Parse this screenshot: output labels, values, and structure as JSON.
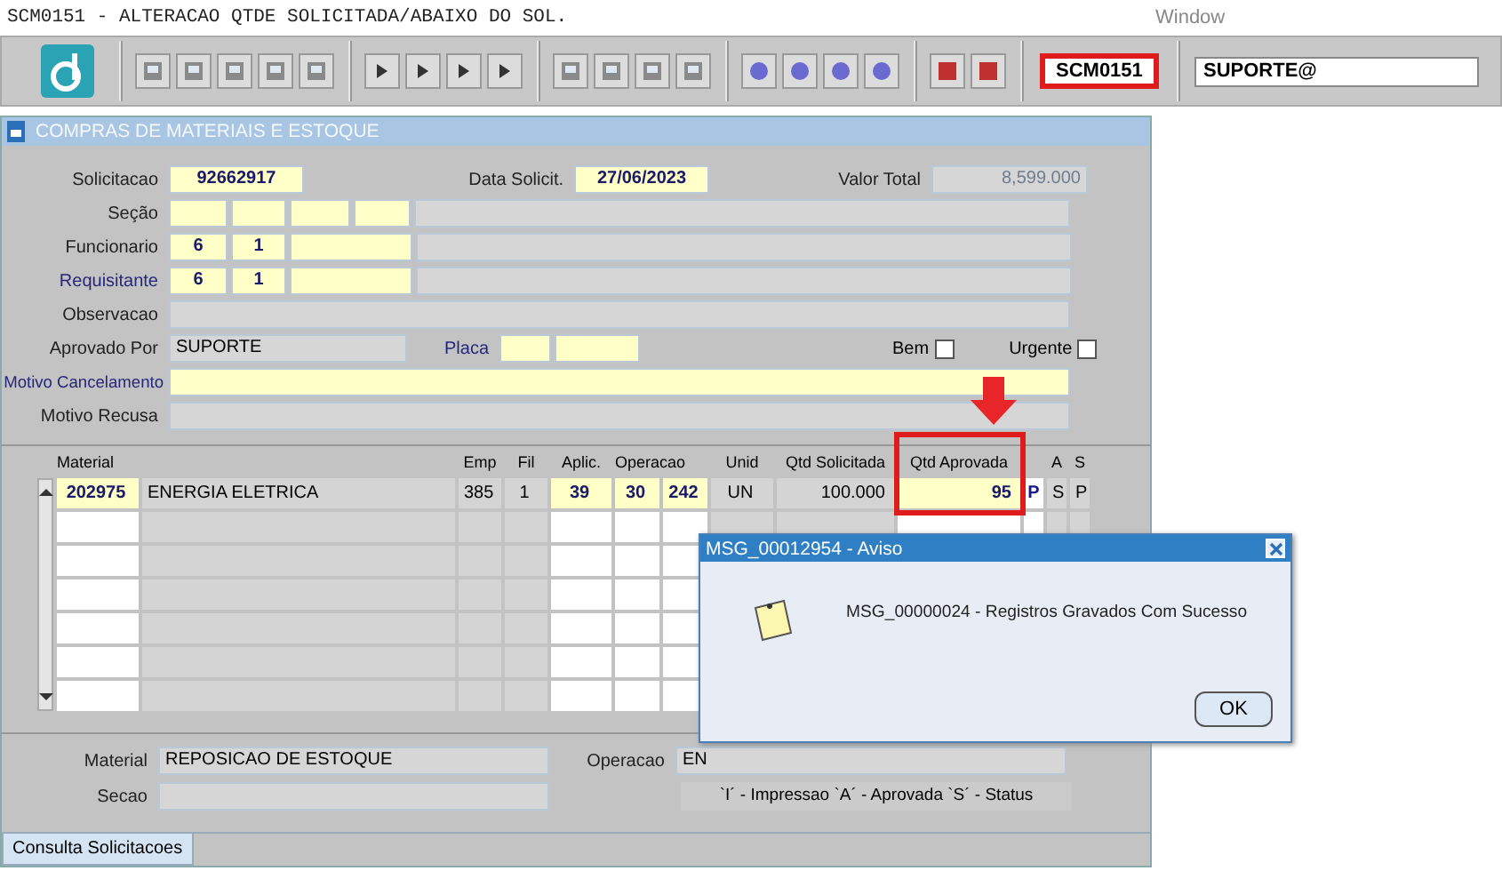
{
  "title_bar": {
    "title": "SCM0151 - ALTERACAO QTDE SOLICITADA/ABAIXO DO SOL.",
    "menu": "Window"
  },
  "toolbar": {
    "form_code": "SCM0151",
    "user": "SUPORTE@"
  },
  "panel": {
    "title": "COMPRAS DE MATERIAIS E ESTOQUE"
  },
  "form": {
    "solicitacao": {
      "label": "Solicitacao",
      "value": "92662917"
    },
    "data_solicit": {
      "label": "Data Solicit.",
      "value": "27/06/2023"
    },
    "valor_total": {
      "label": "Valor Total",
      "value": "8,599.000"
    },
    "secao": {
      "label": "Seção"
    },
    "funcionario": {
      "label": "Funcionario",
      "values": [
        "6",
        "1"
      ]
    },
    "requisitante": {
      "label": "Requisitante",
      "values": [
        "6",
        "1"
      ]
    },
    "observacao": {
      "label": "Observacao"
    },
    "aprovado_por": {
      "label": "Aprovado Por",
      "value": "SUPORTE"
    },
    "placa": {
      "label": "Placa"
    },
    "checkboxes": [
      {
        "label": "Bem",
        "checked": false
      },
      {
        "label": "Urgente",
        "checked": false
      }
    ],
    "motivo_cancelamento": {
      "label": "Motivo Cancelamento"
    },
    "motivo_recusa": {
      "label": "Motivo Recusa"
    }
  },
  "table": {
    "columns": [
      "Material",
      "",
      "Emp",
      "Fil",
      "Aplic.",
      "Operacao",
      "",
      "Unid",
      "Qtd  Solicitada",
      "Qtd Aprovada",
      "",
      "A",
      "S"
    ],
    "rows": [
      {
        "cells": [
          {
            "text": "202975",
            "kind": "edit"
          },
          {
            "text": "ENERGIA ELETRICA",
            "kind": "view"
          },
          {
            "text": "385",
            "kind": "view"
          },
          {
            "text": "1",
            "kind": "view"
          },
          {
            "text": "39",
            "kind": "edit"
          },
          {
            "text": "30",
            "kind": "edit"
          },
          {
            "text": "242",
            "kind": "edit"
          },
          {
            "text": "UN",
            "kind": "view"
          },
          {
            "text": "100.000",
            "kind": "view"
          },
          {
            "text": "95",
            "kind": "edit"
          },
          {
            "text": "P",
            "kind": "flag"
          },
          {
            "text": "S",
            "kind": "view"
          },
          {
            "text": "P",
            "kind": "view"
          }
        ]
      }
    ]
  },
  "footer": {
    "material": {
      "label": "Material",
      "value": "REPOSICAO DE ESTOQUE"
    },
    "secao": {
      "label": "Secao"
    },
    "operacao": {
      "label": "Operacao",
      "value": "EN"
    },
    "legend": "`I´ - Impressao `A´ - Aprovada `S´ - Status"
  },
  "tabs": [
    {
      "label": "Consulta Solicitacoes",
      "selected": true
    }
  ],
  "dialog": {
    "title": "MSG_00012954 - Aviso",
    "message": "MSG_00000024 - Registros Gravados Com Sucesso",
    "button": "OK"
  }
}
